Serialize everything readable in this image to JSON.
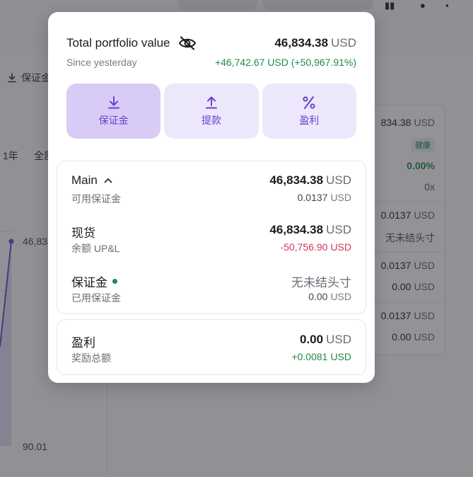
{
  "background": {
    "deposit_label": "保证金",
    "range_1y": "1年",
    "range_all": "全部",
    "chart_top_label": "46,83",
    "chart_bottom_label": "90.01",
    "right_card": {
      "value": "834.38",
      "unit": "USD",
      "health_badge": "健康",
      "percent": "0.00%",
      "leverage": "0x",
      "rows": [
        {
          "value": "0.0137",
          "unit": "USD"
        },
        {
          "value": "无未结头寸",
          "unit": ""
        },
        {
          "value": "0.0137",
          "unit": "USD"
        },
        {
          "value": "0.00",
          "unit": "USD"
        },
        {
          "value": "0.0137",
          "unit": "USD"
        },
        {
          "value": "0.00",
          "unit": "USD"
        }
      ]
    }
  },
  "popup": {
    "title": "Total portfolio value",
    "total_value": "46,834.38",
    "total_unit": "USD",
    "since_label": "Since yesterday",
    "change": "+46,742.67 USD (+50,967.91%)",
    "actions": [
      {
        "label": "保证金",
        "icon": "download-icon"
      },
      {
        "label": "提款",
        "icon": "upload-icon"
      },
      {
        "label": "盈利",
        "icon": "percent-icon"
      }
    ],
    "main": {
      "label": "Main",
      "sublabel": "可用保证金",
      "value": "46,834.38",
      "unit": "USD",
      "subvalue": "0.0137",
      "subunit": "USD"
    },
    "spot": {
      "label": "现货",
      "sublabel": "余额 UP&L",
      "value": "46,834.38",
      "unit": "USD",
      "subvalue": "-50,756.90",
      "subunit": "USD"
    },
    "margin": {
      "label": "保证金",
      "sublabel": "已用保证金",
      "value": "无未结头寸",
      "subvalue": "0.00",
      "subunit": "USD"
    },
    "profit": {
      "label": "盈利",
      "sublabel": "奖励总额",
      "value": "0.00",
      "unit": "USD",
      "subvalue": "+0.0081",
      "subunit": "USD"
    }
  }
}
